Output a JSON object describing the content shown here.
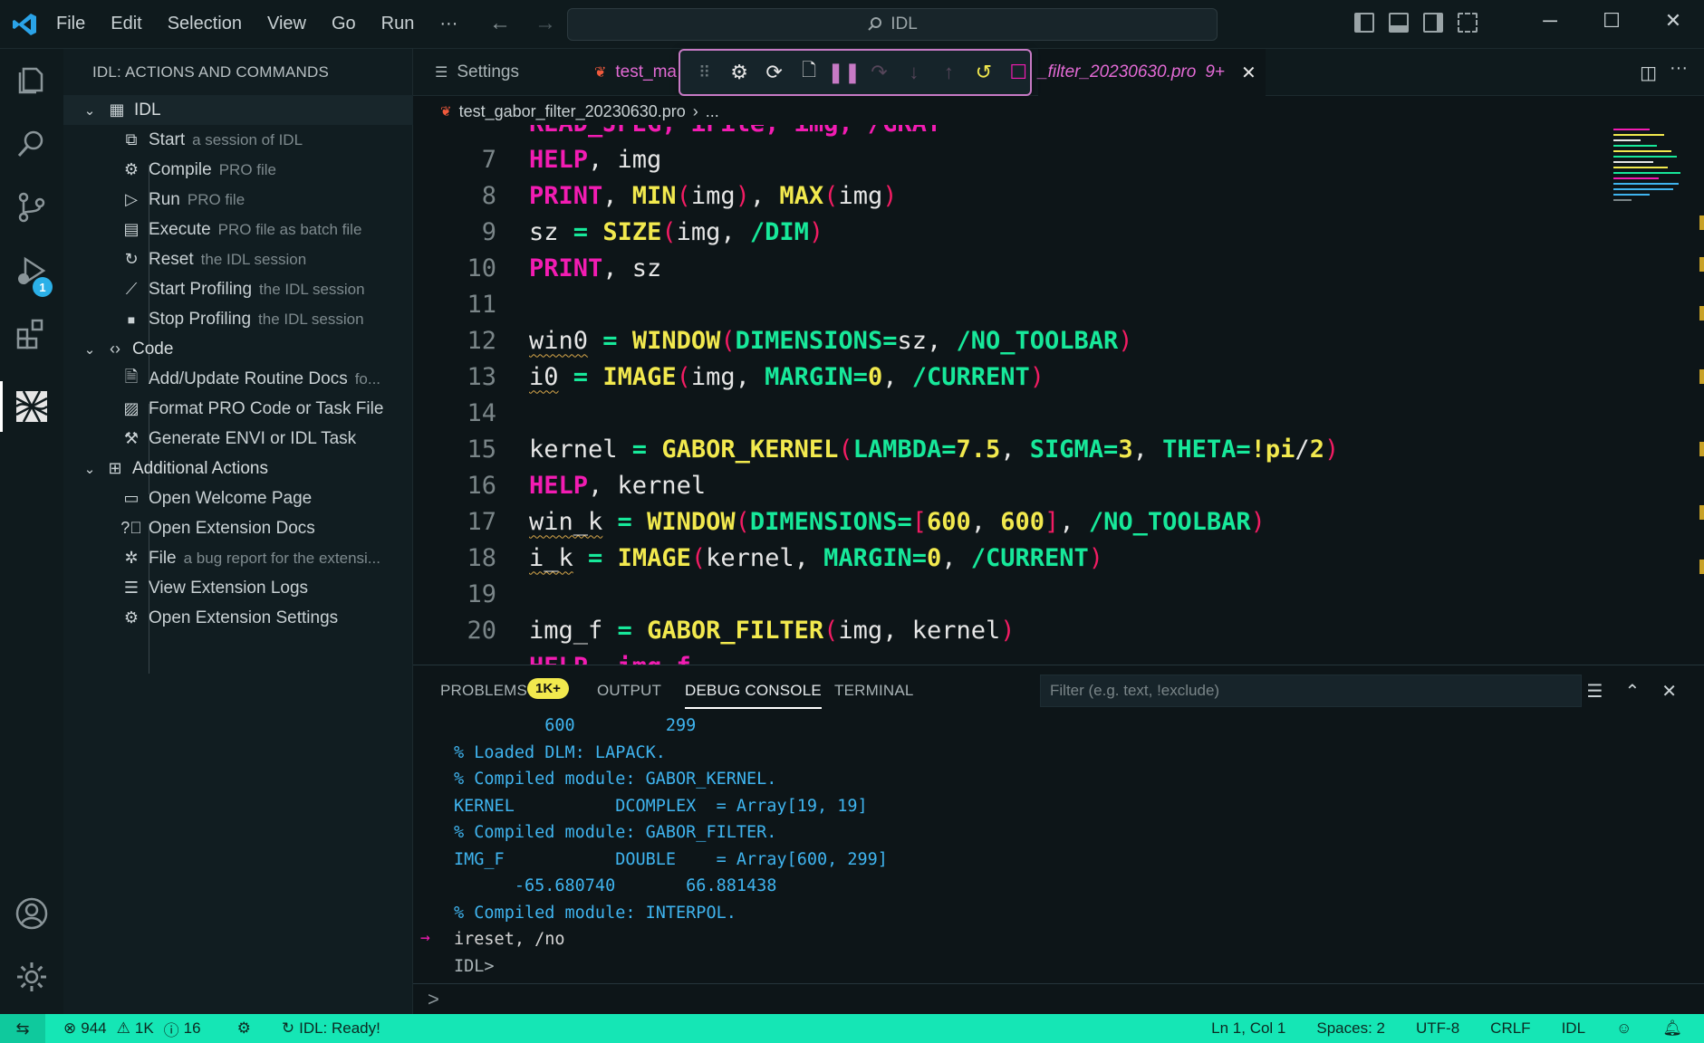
{
  "titlebar": {
    "menu": [
      "File",
      "Edit",
      "Selection",
      "View",
      "Go",
      "Run",
      "···"
    ],
    "search_text": "IDL",
    "window_controls": [
      "─",
      "☐",
      "✕"
    ]
  },
  "activitybar": {
    "debug_badge": "1"
  },
  "sidebar": {
    "title": "IDL: ACTIONS AND COMMANDS",
    "groups": [
      {
        "label": "IDL",
        "items": [
          {
            "label": "Start",
            "desc": "a session of IDL"
          },
          {
            "label": "Compile",
            "desc": "PRO file"
          },
          {
            "label": "Run",
            "desc": "PRO file"
          },
          {
            "label": "Execute",
            "desc": "PRO file as batch file"
          },
          {
            "label": "Reset",
            "desc": "the IDL session"
          },
          {
            "label": "Start Profiling",
            "desc": "the IDL session"
          },
          {
            "label": "Stop Profiling",
            "desc": "the IDL session"
          }
        ]
      },
      {
        "label": "Code",
        "items": [
          {
            "label": "Add/Update Routine Docs",
            "desc": "fo..."
          },
          {
            "label": "Format PRO Code or Task File",
            "desc": ""
          },
          {
            "label": "Generate ENVI or IDL Task",
            "desc": ""
          }
        ]
      },
      {
        "label": "Additional Actions",
        "items": [
          {
            "label": "Open Welcome Page",
            "desc": ""
          },
          {
            "label": "Open Extension Docs",
            "desc": ""
          },
          {
            "label": "File",
            "desc": "a bug report for the extensi..."
          },
          {
            "label": "View Extension Logs",
            "desc": ""
          },
          {
            "label": "Open Extension Settings",
            "desc": ""
          }
        ]
      }
    ]
  },
  "editor": {
    "tabs": [
      {
        "label": "Settings"
      },
      {
        "label": "test_ma"
      },
      {
        "label": "_filter_20230630.pro",
        "suffix": "9+"
      }
    ],
    "breadcrumb": {
      "file": "test_gabor_filter_20230630.pro",
      "more": "..."
    },
    "partial_top_line": "READ_JPEG, iFile, img, /GRAY",
    "line_numbers": [
      "7",
      "8",
      "9",
      "10",
      "11",
      "12",
      "13",
      "14",
      "15",
      "16",
      "17",
      "18",
      "19",
      "20"
    ],
    "lines": [
      "HELP, img",
      "PRINT, MIN(img), MAX(img)",
      "sz = SIZE(img, /DIM)",
      "PRINT, sz",
      "",
      "win0 = WINDOW(DIMENSIONS=sz, /NO_TOOLBAR)",
      "i0 = IMAGE(img, MARGIN=0, /CURRENT)",
      "",
      "kernel = GABOR_KERNEL(LAMBDA=7.5, SIGMA=3, THETA=!pi/2)",
      "HELP, kernel",
      "win_k = WINDOW(DIMENSIONS=[600, 600], /NO_TOOLBAR)",
      "i_k = IMAGE(kernel, MARGIN=0, /CURRENT)",
      "",
      "img_f = GABOR_FILTER(img, kernel)"
    ],
    "partial_bottom_line": "HELP, img_f"
  },
  "panel": {
    "tabs": [
      "PROBLEMS",
      "OUTPUT",
      "DEBUG CONSOLE",
      "TERMINAL"
    ],
    "problems_badge": "1K+",
    "filter_placeholder": "Filter (e.g. text, !exclude)",
    "console_lines": [
      "         600         299",
      "% Loaded DLM: LAPACK.",
      "% Compiled module: GABOR_KERNEL.",
      "KERNEL          DCOMPLEX  = Array[19, 19]",
      "% Compiled module: GABOR_FILTER.",
      "IMG_F           DOUBLE    = Array[600, 299]",
      "      -65.680740       66.881438",
      "% Compiled module: INTERPOL.",
      "ireset, /no",
      "IDL>"
    ],
    "console_arrow": "→",
    "input_prompt": ">"
  },
  "statusbar": {
    "errors": "944",
    "warnings": "1K",
    "infos": "16",
    "idl_status": "IDL: Ready!",
    "position": "Ln 1, Col 1",
    "spaces": "Spaces: 2",
    "encoding": "UTF-8",
    "eol": "CRLF",
    "language": "IDL"
  },
  "colors": {
    "statusbar": "#15e6b5",
    "keyword_pink": "#f21cb2",
    "function_yellow": "#f2e94e",
    "param_green": "#17e89a",
    "console_blue": "#3fb4ef"
  }
}
